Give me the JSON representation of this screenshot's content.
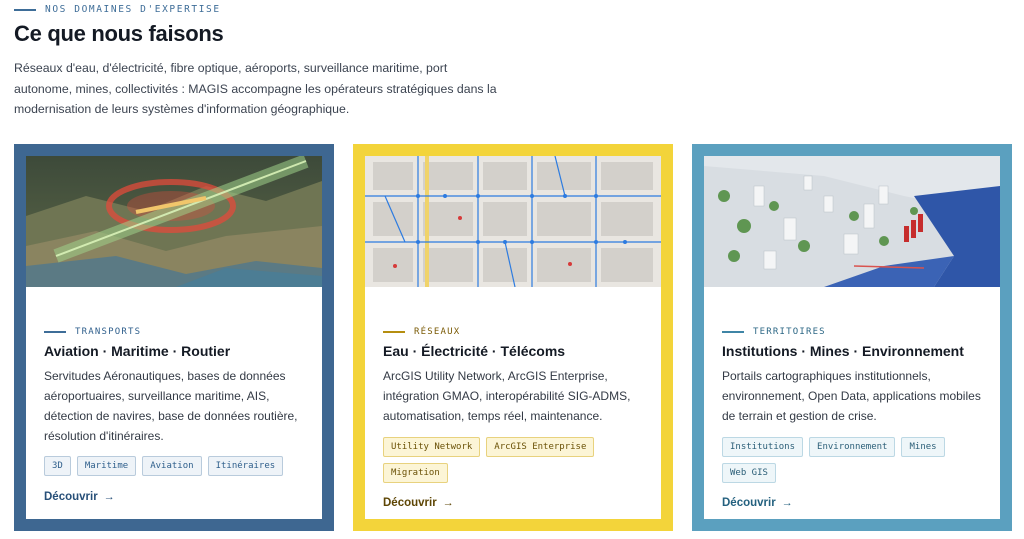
{
  "section": {
    "eyebrow": "NOS DOMAINES D'EXPERTISE",
    "title": "Ce que nous faisons",
    "intro": "Réseaux d'eau, d'électricité, fibre optique, aéroports, surveillance maritime, port autonome, mines, collectivités : MAGIS accompagne les opérateurs stratégiques dans la modernisation de leurs systèmes d'information géographique."
  },
  "colors": {
    "transports": "#3e6791",
    "reseaux": "#f3d43a",
    "territoires": "#5ba0bf"
  },
  "cards": [
    {
      "tag": "TRANSPORTS",
      "title": "Aviation · Maritime · Routier",
      "description": "Servitudes Aéronautiques, bases de données aéroportuaires, surveillance maritime, AIS, détection de navires, base de données routière, résolution d'itinéraires.",
      "chips": [
        "3D",
        "Maritime",
        "Aviation",
        "Itinéraires"
      ],
      "link": "Découvrir",
      "arrow": "→",
      "image_icon": "3d-terrain-aviation-icon"
    },
    {
      "tag": "RÉSEAUX",
      "title": "Eau · Électricité · Télécoms",
      "description": "ArcGIS Utility Network, ArcGIS Enterprise, intégration GMAO, interopérabilité SIG-ADMS, automatisation, temps réel, maintenance.",
      "chips": [
        "Utility Network",
        "ArcGIS Enterprise",
        "Migration"
      ],
      "link": "Découvrir",
      "arrow": "→",
      "image_icon": "utility-network-map-icon"
    },
    {
      "tag": "TERRITOIRES",
      "title": "Institutions · Mines · Environnement",
      "description": "Portails cartographiques institutionnels, environnement, Open Data, applications mobiles de terrain et gestion de crise.",
      "chips": [
        "Institutions",
        "Environnement",
        "Mines",
        "Web GIS"
      ],
      "link": "Découvrir",
      "arrow": "→",
      "image_icon": "3d-city-model-icon"
    }
  ]
}
